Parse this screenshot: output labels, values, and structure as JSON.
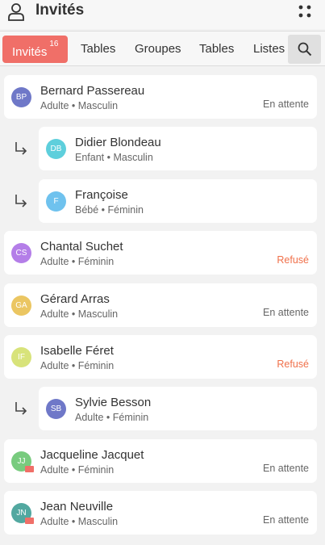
{
  "header": {
    "title": "Invités"
  },
  "tabs": [
    {
      "label": "Invités",
      "badge": "16",
      "active": true
    },
    {
      "label": "Tables"
    },
    {
      "label": "Groupes"
    },
    {
      "label": "Tables"
    },
    {
      "label": "Listes"
    }
  ],
  "guests": [
    {
      "initials": "BP",
      "name": "Bernard Passereau",
      "meta": "Adulte • Masculin",
      "status": "En attente",
      "status_type": "pending",
      "avatar_color": "#6f78c8",
      "child": false,
      "mail": false
    },
    {
      "initials": "DB",
      "name": "Didier Blondeau",
      "meta": "Enfant • Masculin",
      "status": "",
      "status_type": "",
      "avatar_color": "#5ecfdc",
      "child": true,
      "mail": false
    },
    {
      "initials": "F",
      "name": "Françoise",
      "meta": "Bébé • Féminin",
      "status": "",
      "status_type": "",
      "avatar_color": "#6fc2ee",
      "child": true,
      "mail": false
    },
    {
      "initials": "CS",
      "name": "Chantal Suchet",
      "meta": "Adulte • Féminin",
      "status": "Refusé",
      "status_type": "refused",
      "avatar_color": "#b47ee8",
      "child": false,
      "mail": false
    },
    {
      "initials": "GA",
      "name": "Gérard Arras",
      "meta": "Adulte • Masculin",
      "status": "En attente",
      "status_type": "pending",
      "avatar_color": "#ebc662",
      "child": false,
      "mail": false
    },
    {
      "initials": "IF",
      "name": "Isabelle Féret",
      "meta": "Adulte • Féminin",
      "status": "Refusé",
      "status_type": "refused",
      "avatar_color": "#d8e37a",
      "child": false,
      "mail": false
    },
    {
      "initials": "SB",
      "name": "Sylvie Besson",
      "meta": "Adulte • Féminin",
      "status": "",
      "status_type": "",
      "avatar_color": "#6f78c8",
      "child": true,
      "mail": false
    },
    {
      "initials": "JJ",
      "name": "Jacqueline Jacquet",
      "meta": "Adulte • Féminin",
      "status": "En attente",
      "status_type": "pending",
      "avatar_color": "#78cb7e",
      "child": false,
      "mail": true
    },
    {
      "initials": "JN",
      "name": "Jean Neuville",
      "meta": "Adulte • Masculin",
      "status": "En attente",
      "status_type": "pending",
      "avatar_color": "#52a8a0",
      "child": false,
      "mail": true
    }
  ]
}
